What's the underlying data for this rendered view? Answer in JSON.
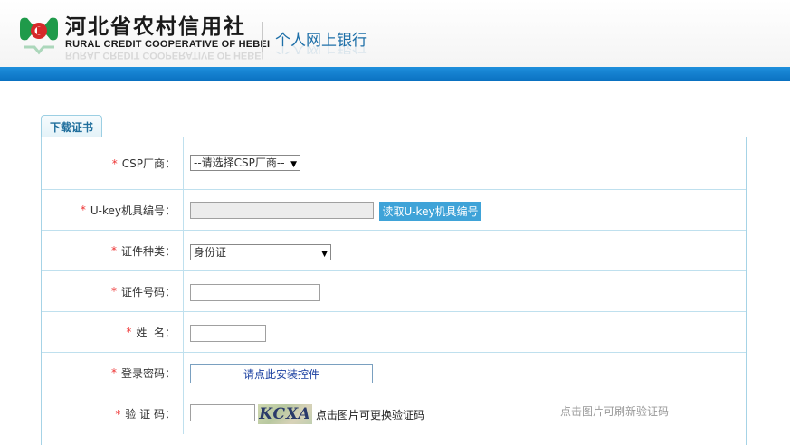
{
  "header": {
    "bank_name_cn": "河北省农村信用社",
    "bank_name_en": "RURAL CREDIT COOPERATIVE OF HEBEI",
    "subtitle": "个人网上银行"
  },
  "tab": {
    "label": "下载证书"
  },
  "form": {
    "star": "*",
    "csp": {
      "label": "CSP厂商：",
      "selected": "--请选择CSP厂商--"
    },
    "ukey": {
      "label": "U-key机具编号：",
      "value": "",
      "button": "读取U-key机具编号"
    },
    "id_type": {
      "label": "证件种类：",
      "selected": "身份证"
    },
    "id_number": {
      "label": "证件号码：",
      "value": ""
    },
    "name": {
      "label": "姓  名：",
      "value": ""
    },
    "password": {
      "label": "登录密码：",
      "placeholder_text": "请点此安装控件"
    },
    "captcha": {
      "label": "验 证 码：",
      "value": "",
      "image_text": "KCXA",
      "refresh_text": "点击图片可更换验证码",
      "hint": "点击图片可刷新验证码"
    }
  },
  "colors": {
    "accent_blue": "#0a70c0",
    "required_star": "#e33333",
    "button_blue": "#3fa3d8"
  }
}
